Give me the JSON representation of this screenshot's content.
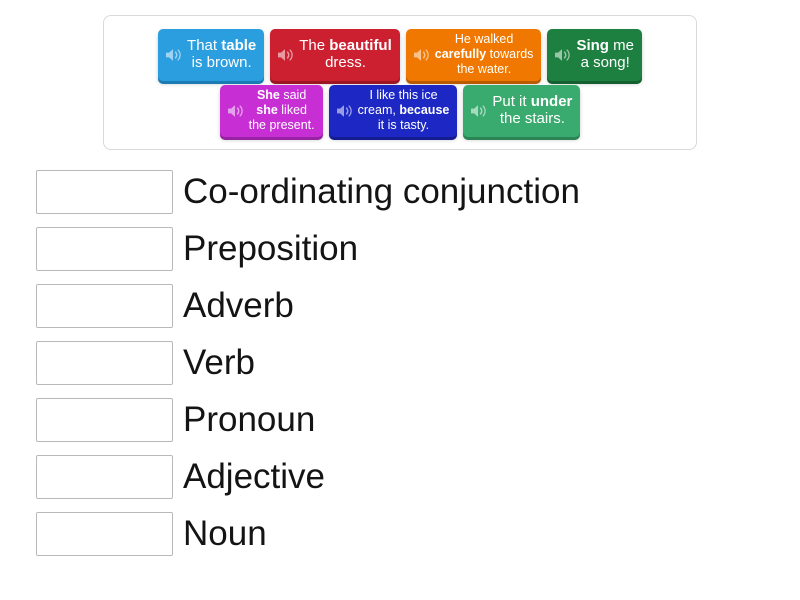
{
  "activity": {
    "type": "match-up",
    "speaker_icon": "speaker-icon"
  },
  "tiles": {
    "rows": [
      [
        {
          "id": "tile-that-table",
          "name": "tile-that-table",
          "color": "#2b9ee0",
          "shadow": "#1b7bb4",
          "size": "md",
          "lines": [
            [
              {
                "t": "That ",
                "b": false
              },
              {
                "t": "table",
                "b": true
              }
            ],
            [
              {
                "t": "is brown.",
                "b": false
              }
            ]
          ],
          "plain": "That table is brown."
        },
        {
          "id": "tile-the-beautiful-dress",
          "name": "tile-the-beautiful-dress",
          "color": "#cc2030",
          "shadow": "#9c1723",
          "size": "md",
          "lines": [
            [
              {
                "t": "The ",
                "b": false
              },
              {
                "t": "beautiful",
                "b": true
              }
            ],
            [
              {
                "t": "dress.",
                "b": false
              }
            ]
          ],
          "plain": "The beautiful dress."
        },
        {
          "id": "tile-he-walked-carefully",
          "name": "tile-he-walked-carefully",
          "color": "#f07800",
          "shadow": "#b95c00",
          "size": "sm",
          "lines": [
            [
              {
                "t": "He walked",
                "b": false
              }
            ],
            [
              {
                "t": "carefully",
                "b": true
              },
              {
                "t": " towards",
                "b": false
              }
            ],
            [
              {
                "t": "the water.",
                "b": false
              }
            ]
          ],
          "plain": "He walked carefully towards the water."
        },
        {
          "id": "tile-sing-me-a-song",
          "name": "tile-sing-me-a-song",
          "color": "#1e8040",
          "shadow": "#156030",
          "size": "md",
          "lines": [
            [
              {
                "t": "Sing",
                "b": true
              },
              {
                "t": " me",
                "b": false
              }
            ],
            [
              {
                "t": "a song!",
                "b": false
              }
            ]
          ],
          "plain": "Sing me a song!"
        }
      ],
      [
        {
          "id": "tile-she-said-she-liked",
          "name": "tile-she-said-she-liked",
          "color": "#c72fd4",
          "shadow": "#9722a2",
          "size": "sm",
          "lines": [
            [
              {
                "t": "She",
                "b": true
              },
              {
                "t": " said",
                "b": false
              }
            ],
            [
              {
                "t": "she",
                "b": true
              },
              {
                "t": " liked",
                "b": false
              }
            ],
            [
              {
                "t": "the present.",
                "b": false
              }
            ]
          ],
          "plain": "She said she liked the present."
        },
        {
          "id": "tile-i-like-this-ice-cream",
          "name": "tile-i-like-this-ice-cream",
          "color": "#1d28c4",
          "shadow": "#141c90",
          "size": "sm",
          "lines": [
            [
              {
                "t": "I like this ice",
                "b": false
              }
            ],
            [
              {
                "t": "cream, ",
                "b": false
              },
              {
                "t": "because",
                "b": true
              }
            ],
            [
              {
                "t": "it is tasty.",
                "b": false
              }
            ]
          ],
          "plain": "I like this ice cream, because it is tasty."
        },
        {
          "id": "tile-put-it-under-the-stairs",
          "name": "tile-put-it-under-the-stairs",
          "color": "#3aab6e",
          "shadow": "#2a8453",
          "size": "md",
          "lines": [
            [
              {
                "t": "Put it ",
                "b": false
              },
              {
                "t": "under",
                "b": true
              }
            ],
            [
              {
                "t": "the stairs.",
                "b": false
              }
            ]
          ],
          "plain": "Put it under the stairs."
        }
      ]
    ]
  },
  "answers": [
    {
      "id": "answer-co-ordinating-conjunction",
      "label": "Co-ordinating conjunction",
      "dropped": ""
    },
    {
      "id": "answer-preposition",
      "label": "Preposition",
      "dropped": ""
    },
    {
      "id": "answer-adverb",
      "label": "Adverb",
      "dropped": ""
    },
    {
      "id": "answer-verb",
      "label": "Verb",
      "dropped": ""
    },
    {
      "id": "answer-pronoun",
      "label": "Pronoun",
      "dropped": ""
    },
    {
      "id": "answer-adjective",
      "label": "Adjective",
      "dropped": ""
    },
    {
      "id": "answer-noun",
      "label": "Noun",
      "dropped": ""
    }
  ]
}
